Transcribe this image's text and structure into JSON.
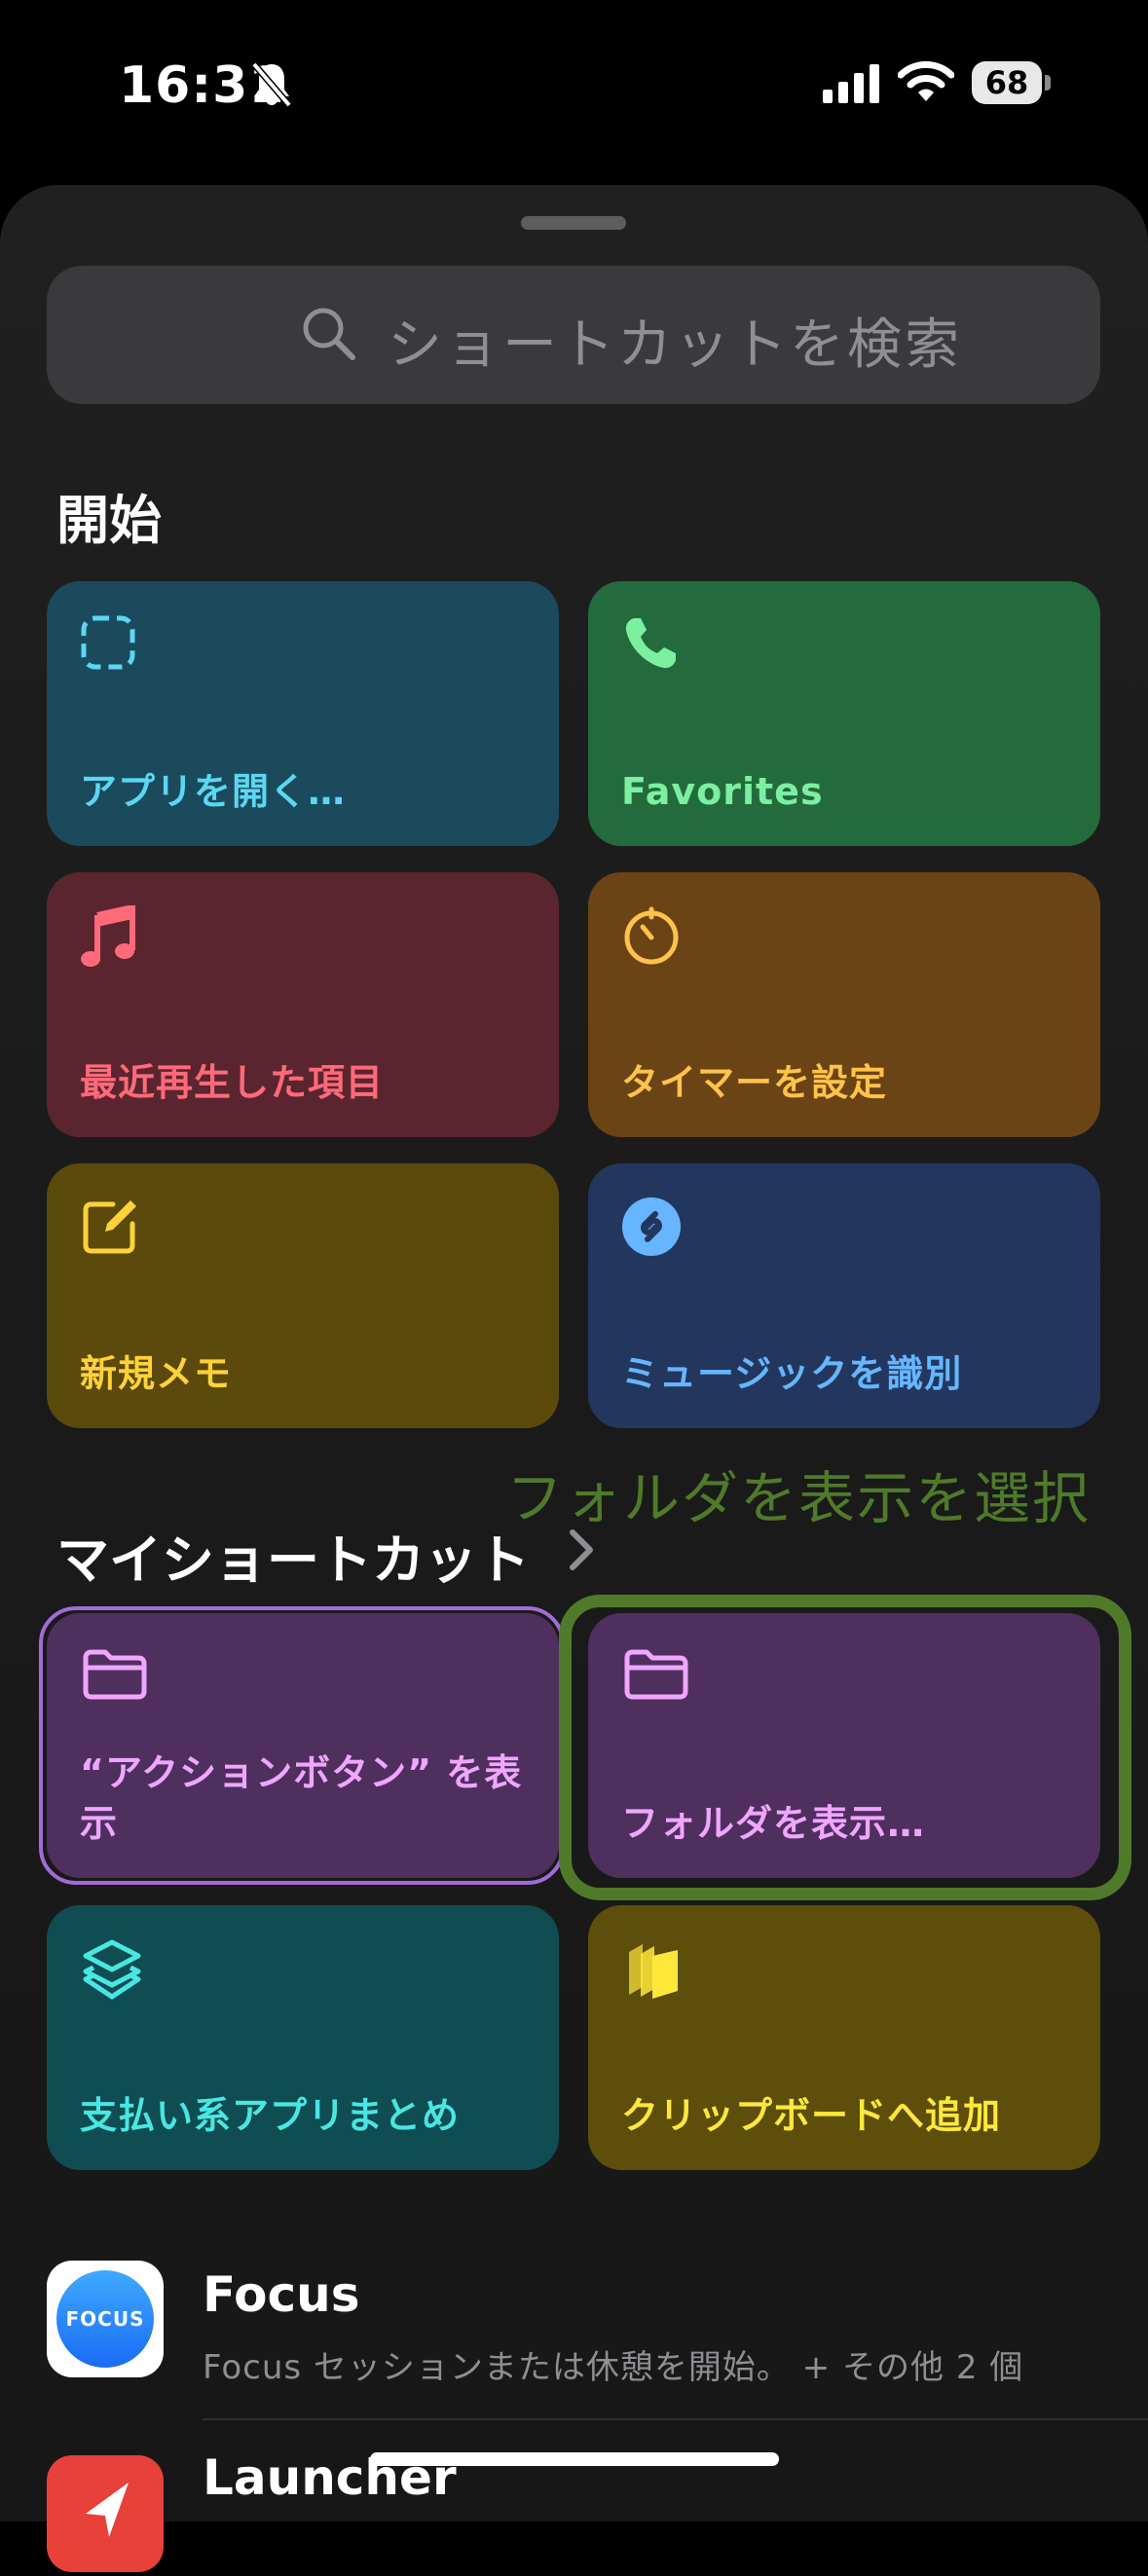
{
  "status_bar": {
    "time": "16:31",
    "battery": "68"
  },
  "search": {
    "placeholder": "ショートカットを検索"
  },
  "start_section": {
    "title": "開始",
    "tiles": [
      {
        "label": "アプリを開く…",
        "icon": "dashed-square-icon",
        "color": "#1b4a5c"
      },
      {
        "label": "Favorites",
        "icon": "phone-icon",
        "color": "#236b3c"
      },
      {
        "label": "最近再生した項目",
        "icon": "music-note-icon",
        "color": "#5b2530"
      },
      {
        "label": "タイマーを設定",
        "icon": "timer-icon",
        "color": "#6a4414"
      },
      {
        "label": "新規メモ",
        "icon": "compose-icon",
        "color": "#5c4a0c"
      },
      {
        "label": "ミュージックを識別",
        "icon": "shazam-icon",
        "color": "#23375e"
      }
    ]
  },
  "annotation": "フォルダを表示を選択",
  "my_shortcuts": {
    "title": "マイショートカット",
    "tiles": [
      {
        "label": "“アクションボタン” を表示",
        "icon": "folder-icon",
        "color": "#4e2f5e"
      },
      {
        "label": "フォルダを表示…",
        "icon": "folder-icon",
        "color": "#4e2f5e"
      },
      {
        "label": "支払い系アプリまとめ",
        "icon": "layers-icon",
        "color": "#0f4d52"
      },
      {
        "label": "クリップボードへ追加",
        "icon": "clipboard-stack-icon",
        "color": "#5e4e0c"
      }
    ]
  },
  "apps": [
    {
      "name": "Focus",
      "icon_text": "FOCUS",
      "subtitle": "Focus セッションまたは休憩を開始。 + その他 2 個"
    },
    {
      "name": "Launcher"
    }
  ]
}
